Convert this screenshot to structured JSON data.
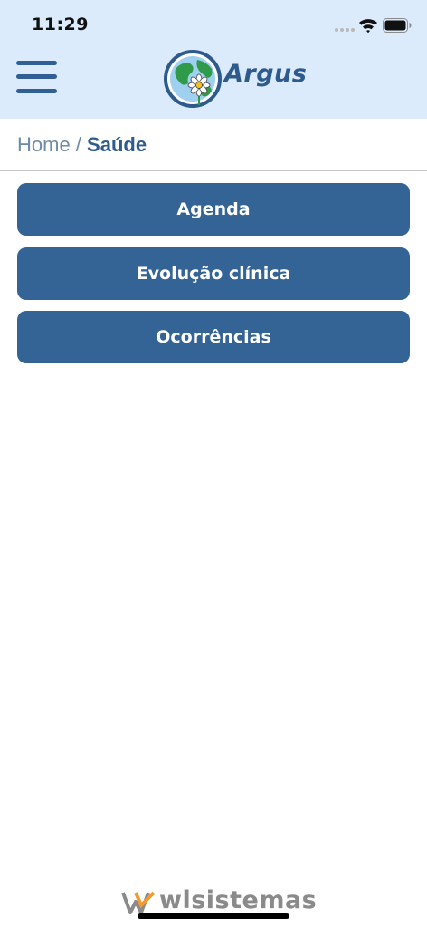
{
  "status_bar": {
    "time": "11:29"
  },
  "header": {
    "logo_text": "Argus",
    "background_color": "#dcebfb",
    "accent_color": "#2e5b8d"
  },
  "breadcrumb": {
    "root": "Home",
    "separator": " / ",
    "current": "Saúde"
  },
  "menu": {
    "items": [
      {
        "label": "Agenda"
      },
      {
        "label": "Evolução clínica"
      },
      {
        "label": "Ocorrências"
      }
    ],
    "button_color": "#346495"
  },
  "footer": {
    "brand": "wlsistemas"
  },
  "icons": {
    "menu": "hamburger-menu-icon",
    "signal": "cellular-signal-icon",
    "wifi": "wifi-icon",
    "battery": "battery-icon",
    "logo": "globe-flower-logo-icon",
    "footer_logo": "wl-logo-icon"
  }
}
